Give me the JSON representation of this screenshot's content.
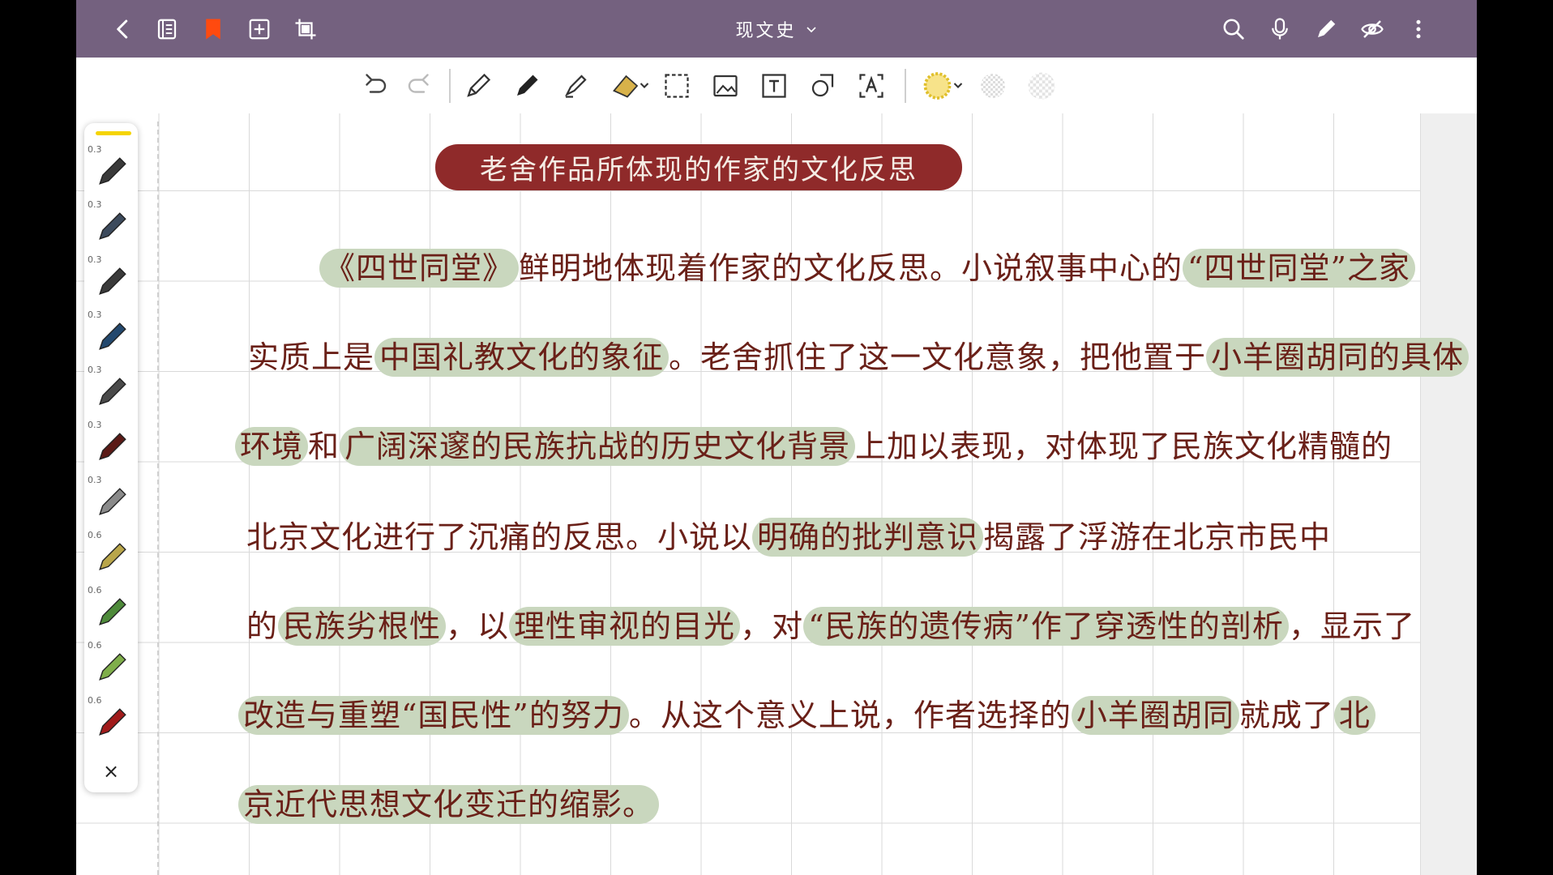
{
  "app": {
    "title": "现文史",
    "colors": {
      "topbar": "#74617f",
      "ink": "#6a2018",
      "heading_bg": "#8f2a2a",
      "highlight": "#c9d7be",
      "bookmark": "#ff4a0f"
    }
  },
  "topbar": {
    "icons": [
      "chevron-left-icon",
      "outline-icon",
      "bookmark-icon",
      "add-page-icon",
      "crop-icon",
      "search-icon",
      "mic-icon",
      "pen-icon",
      "hide-icon",
      "more-icon"
    ]
  },
  "toolbar": {
    "tools": [
      "undo-icon",
      "redo-icon",
      "pencil-icon",
      "pen-icon",
      "highlighter-icon",
      "eraser-icon",
      "lasso-icon",
      "image-icon",
      "text-icon",
      "shape-icon",
      "ocr-icon",
      "color-icon",
      "texture1-icon",
      "texture2-icon"
    ]
  },
  "pens": [
    {
      "size": "0.3",
      "color": "#3a3a3a"
    },
    {
      "size": "0.3",
      "color": "#3c4a5c"
    },
    {
      "size": "0.3",
      "color": "#3a3a3a"
    },
    {
      "size": "0.3",
      "color": "#23486e"
    },
    {
      "size": "0.3",
      "color": "#4a4a4a"
    },
    {
      "size": "0.3",
      "color": "#5b1a16"
    },
    {
      "size": "0.3",
      "color": "#8a8a8a"
    },
    {
      "size": "0.6",
      "color": "#b9a64a"
    },
    {
      "size": "0.6",
      "color": "#4e8a3a"
    },
    {
      "size": "0.6",
      "color": "#7fae4a"
    },
    {
      "size": "0.6",
      "color": "#a11b1b"
    }
  ],
  "panel": {
    "close": "×"
  },
  "note": {
    "heading": "老舍作品所体现的作家的文化反思",
    "lines": [
      [
        "《四世同堂》",
        "鲜明地体现着作家的文化反思。小说叙事中心的",
        "“四世同堂”之家",
        ""
      ],
      [
        "实质上是",
        "中国礼教文化的象征",
        "。老舍抓住了这一文化意象，把他置于",
        "小羊圈胡同的具体"
      ],
      [
        "环境",
        "和",
        "广阔深邃的民族抗战的历史文化背景",
        "上加以表现，对体现了民族文化精髓的"
      ],
      [
        "北京文化进行了沉痛的反思。小说以",
        "明确的批判意识",
        "揭露了浮游在北京市民中",
        ""
      ],
      [
        "的",
        "民族劣根性",
        "，以",
        "理性审视的目光",
        "，对",
        "“民族的遗传病”作了穿透性的剖析",
        "，显示了"
      ],
      [
        "改造与重塑“国民性”的努力",
        "。从这个意义上说，作者选择的",
        "小羊圈胡同",
        "就成了",
        "北"
      ],
      [
        "京近代思想文化变迁的缩影。"
      ]
    ]
  }
}
